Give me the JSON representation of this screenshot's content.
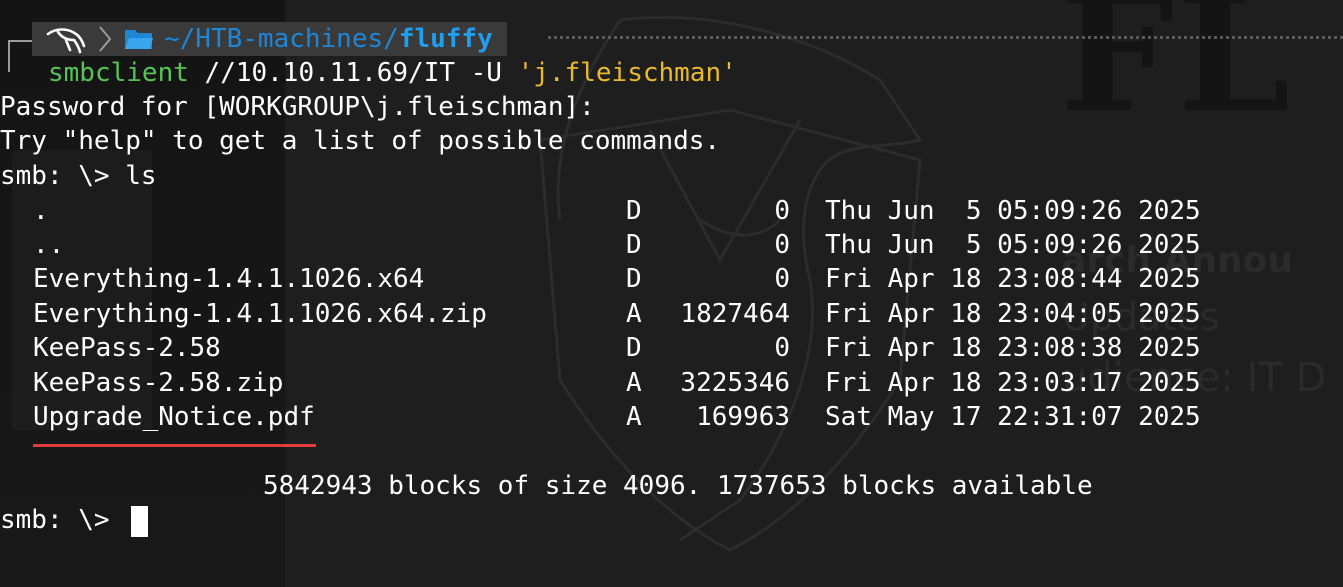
{
  "prompt": {
    "path_prefix": "~/HTB-machines/",
    "path_current": "fluffy",
    "icons": [
      "kali-dragon-icon",
      "chevron-right-icon",
      "folder-icon"
    ]
  },
  "command": {
    "program": "smbclient",
    "args": " //10.10.11.69/IT -U ",
    "user_arg": "'j.fleischman'"
  },
  "output": {
    "password_line": "Password for [WORKGROUP\\j.fleischman]:",
    "help_line": "Try \"help\" to get a list of possible commands.",
    "ls_prompt": "smb: \\> ls",
    "entries": [
      {
        "name": ".",
        "attr": "D",
        "size": "0",
        "date": "Thu Jun  5 05:09:26 2025"
      },
      {
        "name": "..",
        "attr": "D",
        "size": "0",
        "date": "Thu Jun  5 05:09:26 2025"
      },
      {
        "name": "Everything-1.4.1.1026.x64",
        "attr": "D",
        "size": "0",
        "date": "Fri Apr 18 23:08:44 2025"
      },
      {
        "name": "Everything-1.4.1.1026.x64.zip",
        "attr": "A",
        "size": "1827464",
        "date": "Fri Apr 18 23:04:05 2025"
      },
      {
        "name": "KeePass-2.58",
        "attr": "D",
        "size": "0",
        "date": "Fri Apr 18 23:08:38 2025"
      },
      {
        "name": "KeePass-2.58.zip",
        "attr": "A",
        "size": "3225346",
        "date": "Fri Apr 18 23:03:17 2025"
      },
      {
        "name": "Upgrade_Notice.pdf",
        "attr": "A",
        "size": "169963",
        "date": "Sat May 17 22:31:07 2025"
      }
    ],
    "blocks_line": "5842943 blocks of size 4096. 1737653 blocks available",
    "final_prompt": "smb: \\> "
  },
  "background": {
    "watermark_letters": "FL",
    "watermark_lines": [
      "arch Annou",
      "Updates",
      "udience: IT D"
    ]
  },
  "colors": {
    "prompt_green": "#55c455",
    "arg_yellow": "#e8b92a",
    "path_blue": "#1f86d6",
    "highlight_red": "#e03c3c"
  }
}
